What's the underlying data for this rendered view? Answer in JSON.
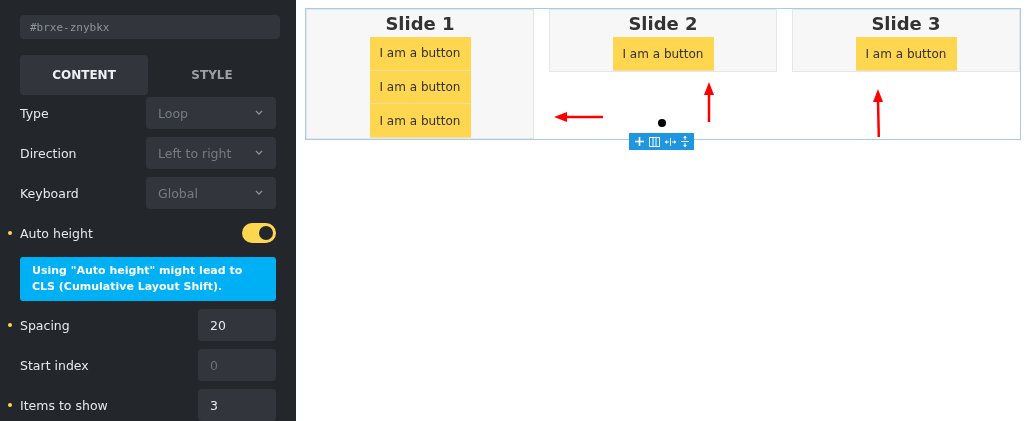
{
  "panel": {
    "css_id": {
      "placeholder": "#brxe-znybkx"
    },
    "tabs": [
      {
        "label": "CONTENT",
        "selected": true
      },
      {
        "label": "STYLE",
        "selected": false
      }
    ],
    "controls": [
      {
        "kind": "select",
        "label": "Type",
        "placeholder": "Loop",
        "modified": false
      },
      {
        "kind": "select",
        "label": "Direction",
        "placeholder": "Left to right",
        "modified": false
      },
      {
        "kind": "select",
        "label": "Keyboard",
        "placeholder": "Global",
        "modified": false
      },
      {
        "kind": "toggle",
        "label": "Auto height",
        "on": true,
        "modified": true
      },
      {
        "kind": "notice",
        "text": "Using \"Auto height\" might lead to CLS (Cumulative Layout Shift)."
      },
      {
        "kind": "number",
        "label": "Spacing",
        "value": "20",
        "modified": true
      },
      {
        "kind": "number",
        "label": "Start index",
        "placeholder": "0",
        "modified": false
      },
      {
        "kind": "number",
        "label": "Items to show",
        "value": "3",
        "modified": true
      }
    ]
  },
  "canvas": {
    "slides": [
      {
        "title": "Slide 1",
        "buttons": [
          "I am a button",
          "I am a button",
          "I am a button"
        ]
      },
      {
        "title": "Slide 2",
        "buttons": [
          "I am a button"
        ]
      },
      {
        "title": "Slide 3",
        "buttons": [
          "I am a button"
        ]
      }
    ]
  }
}
